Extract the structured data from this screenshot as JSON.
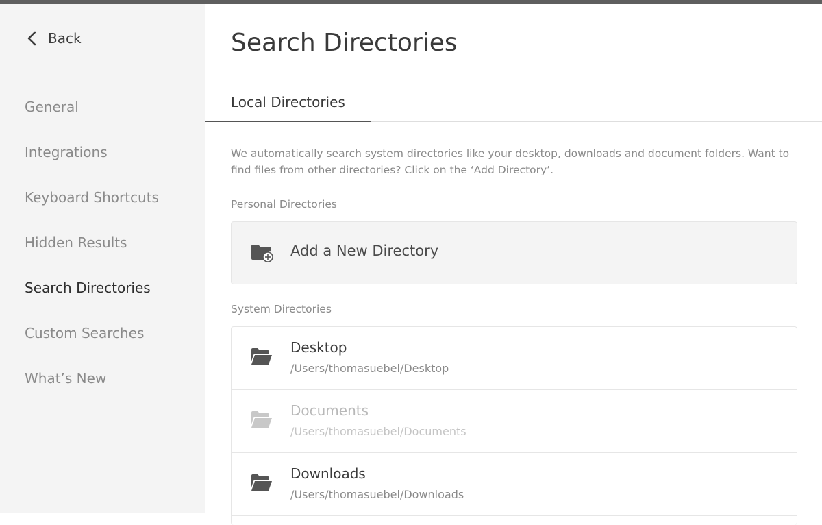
{
  "sidebar": {
    "back_label": "Back",
    "items": [
      {
        "label": "General",
        "active": false
      },
      {
        "label": "Integrations",
        "active": false
      },
      {
        "label": "Keyboard Shortcuts",
        "active": false
      },
      {
        "label": "Hidden Results",
        "active": false
      },
      {
        "label": "Search Directories",
        "active": true
      },
      {
        "label": "Custom Searches",
        "active": false
      },
      {
        "label": "What’s New",
        "active": false
      }
    ]
  },
  "main": {
    "title": "Search Directories",
    "tabs": [
      {
        "label": "Local Directories",
        "active": true
      }
    ],
    "intro": "We automatically search system directories like your desktop, downloads and document folders. Want to find files from other directories? Click on the ‘Add Directory’.",
    "personal_label": "Personal Directories",
    "add_directory_label": "Add a New Directory",
    "system_label": "System Directories",
    "system_directories": [
      {
        "name": "Desktop",
        "path": "/Users/thomasuebel/Desktop",
        "enabled": true,
        "icon": "folder-open-icon"
      },
      {
        "name": "Documents",
        "path": "/Users/thomasuebel/Documents",
        "enabled": false,
        "icon": "folder-open-icon"
      },
      {
        "name": "Downloads",
        "path": "/Users/thomasuebel/Downloads",
        "enabled": true,
        "icon": "folder-open-icon"
      }
    ]
  },
  "colors": {
    "top_bar": "#5f5f5f",
    "sidebar_bg": "#f4f4f4",
    "text_primary": "#3a3a3a",
    "text_muted": "#8a8a8a",
    "text_disabled": "#b8b8b8"
  }
}
